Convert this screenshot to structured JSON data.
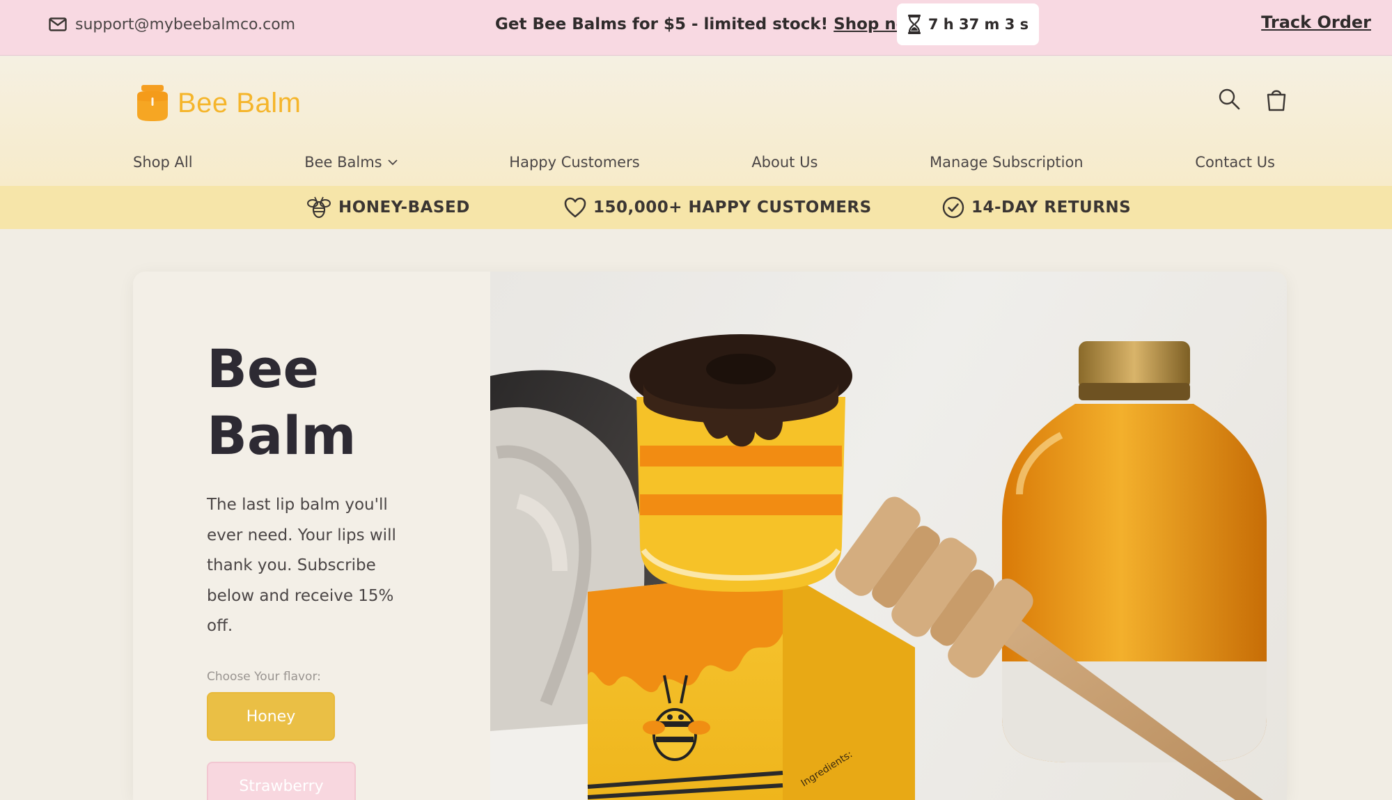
{
  "announcement": {
    "email": "support@mybeebalmco.com",
    "promo_text": "Get Bee Balms for $5 - limited stock!",
    "promo_link": "Shop now",
    "timer": "7 h 37 m 3 s",
    "track_order": "Track Order"
  },
  "header": {
    "logo_text": "Bee Balm",
    "icons": [
      "search-icon",
      "cart-icon"
    ],
    "nav": [
      {
        "label": "Shop All"
      },
      {
        "label": "Bee Balms",
        "has_dropdown": true
      },
      {
        "label": "Happy Customers"
      },
      {
        "label": "About Us"
      },
      {
        "label": "Manage Subscription"
      },
      {
        "label": "Contact Us"
      }
    ]
  },
  "features": [
    {
      "icon": "bee-icon",
      "label": "HONEY-BASED"
    },
    {
      "icon": "heart-icon",
      "label": "150,000+ HAPPY CUSTOMERS"
    },
    {
      "icon": "check-circle-icon",
      "label": "14-DAY RETURNS"
    }
  ],
  "hero": {
    "title": "Bee Balm",
    "description": "The last lip balm you'll ever need. Your lips will thank you. Subscribe below and receive 15% off.",
    "flavor_label": "Choose Your flavor:",
    "flavors": [
      "Honey",
      "Strawberry"
    ],
    "image_text": "Ingredients:"
  },
  "colors": {
    "announcement_bg": "#f8d9e2",
    "features_bg": "#f6e5a9",
    "brand_yellow": "#f5b52b",
    "honey_button": "#eabf45",
    "strawberry_button": "#f8d7df"
  }
}
